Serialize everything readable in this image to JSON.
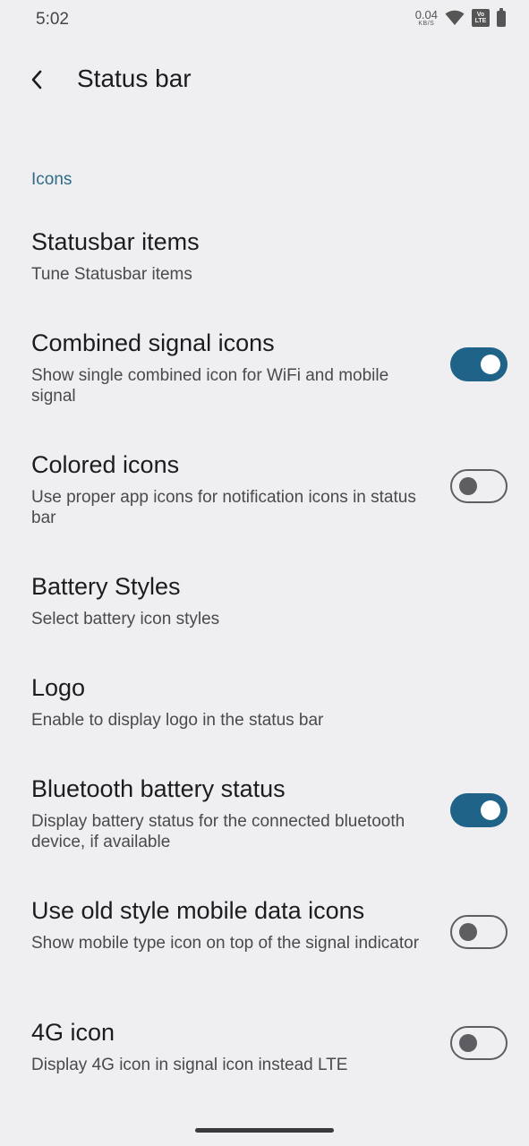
{
  "status_bar": {
    "time": "5:02",
    "net_speed_value": "0.04",
    "net_speed_unit": "KB/S",
    "volte_top": "Vo",
    "volte_bottom": "LTE",
    "icons": [
      "wifi-icon",
      "volte-icon",
      "battery-icon"
    ]
  },
  "app_bar": {
    "title": "Status bar",
    "back_icon": "back-arrow-icon"
  },
  "section": {
    "label": "Icons"
  },
  "items": [
    {
      "title": "Statusbar items",
      "summary": "Tune Statusbar items"
    },
    {
      "title": "Combined signal icons",
      "summary": "Show single combined icon for WiFi and mobile signal",
      "toggle": true
    },
    {
      "title": "Colored icons",
      "summary": "Use proper app icons for notification icons in status bar",
      "toggle": false
    },
    {
      "title": "Battery Styles",
      "summary": "Select battery icon styles"
    },
    {
      "title": "Logo",
      "summary": "Enable to display logo in the status bar"
    },
    {
      "title": "Bluetooth battery status",
      "summary": "Display battery status for the connected bluetooth device, if available",
      "toggle": true
    },
    {
      "title": "Use old style mobile data icons",
      "summary": "Show mobile type icon on top of the signal indicator",
      "toggle": false
    },
    {
      "title": "4G icon",
      "summary": "Display 4G icon in signal icon instead LTE",
      "toggle": false
    }
  ],
  "colors": {
    "background": "#efeff1",
    "accent": "#1f6389",
    "section_header": "#2e6b87"
  }
}
